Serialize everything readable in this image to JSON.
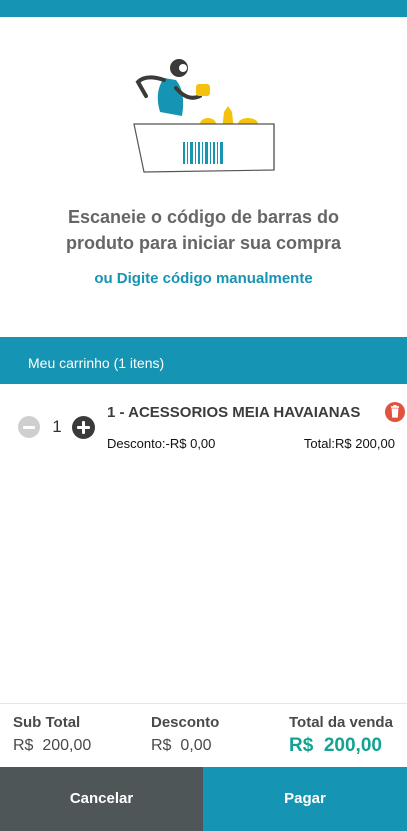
{
  "scanner": {
    "instruction_line1": "Escaneie o código de barras do",
    "instruction_line2": "produto para iniciar sua compra",
    "manual_link": "ou Digite código manualmente"
  },
  "cart": {
    "header": "Meu carrinho (1 itens)",
    "items": [
      {
        "quantity": "1",
        "name": "1 - ACESSORIOS MEIA HAVAIANAS",
        "discount": "Desconto:-R$ 0,00",
        "total": "Total:R$ 200,00"
      }
    ]
  },
  "summary": {
    "subtotal_label": "Sub Total",
    "subtotal_value": "R$  200,00",
    "discount_label": "Desconto",
    "discount_value": "R$  0,00",
    "grand_total_label": "Total da venda",
    "grand_total_value": "R$  200,00"
  },
  "actions": {
    "cancel_label": "Cancelar",
    "pay_label": "Pagar"
  },
  "icons": {
    "decrease": "minus-circle-icon",
    "increase": "plus-circle-icon",
    "remove": "trash-icon"
  },
  "colors": {
    "primary": "#1694b3",
    "cancel": "#4e5658",
    "total_green": "#12a391",
    "delete_red": "#e0533f"
  }
}
